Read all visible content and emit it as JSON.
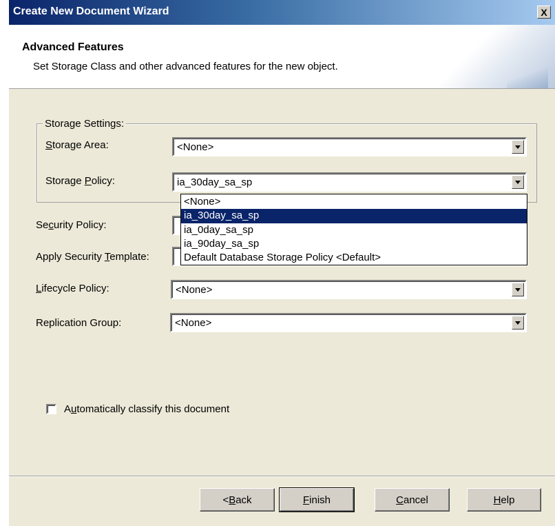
{
  "window": {
    "title": "Create New Document Wizard",
    "close_label": "X"
  },
  "header": {
    "title": "Advanced Features",
    "subtitle": "Set Storage Class and other advanced features for the new object."
  },
  "storage_settings": {
    "group_label": "Storage Settings:",
    "storage_area": {
      "label_pre": "",
      "label_key": "S",
      "label_post": "torage Area:",
      "value": "<None>"
    },
    "storage_policy": {
      "label_pre": "Storage ",
      "label_key": "P",
      "label_post": "olicy:",
      "value": "ia_30day_sa_sp"
    }
  },
  "dropdown": {
    "options": [
      "<None>",
      "ia_30day_sa_sp",
      "ia_0day_sa_sp",
      "ia_90day_sa_sp",
      "Default Database Storage Policy <Default>"
    ],
    "selected_index": 1
  },
  "security_policy": {
    "label_pre": "Se",
    "label_key": "c",
    "label_post": "urity Policy:"
  },
  "apply_security_template": {
    "label_pre": "Apply Security ",
    "label_key": "T",
    "label_post": "emplate:"
  },
  "lifecycle_policy": {
    "label_pre": "",
    "label_key": "L",
    "label_post": "ifecycle Policy:",
    "value": "<None>"
  },
  "replication_group": {
    "label_pre": "Replication Group:",
    "label_key": "",
    "label_post": "",
    "value": "<None>"
  },
  "auto_classify": {
    "label_pre": "A",
    "label_key": "u",
    "label_post": "tomatically classify this document",
    "checked": false
  },
  "buttons": {
    "back": {
      "pre": "< ",
      "key": "B",
      "post": "ack"
    },
    "finish": {
      "pre": "",
      "key": "F",
      "post": "inish"
    },
    "cancel": {
      "pre": "",
      "key": "C",
      "post": "ancel"
    },
    "help": {
      "pre": "",
      "key": "H",
      "post": "elp"
    }
  },
  "colors": {
    "selection": "#0a246a",
    "dialog_bg": "#ece9d8",
    "title_gradient_start": "#0a246a"
  }
}
